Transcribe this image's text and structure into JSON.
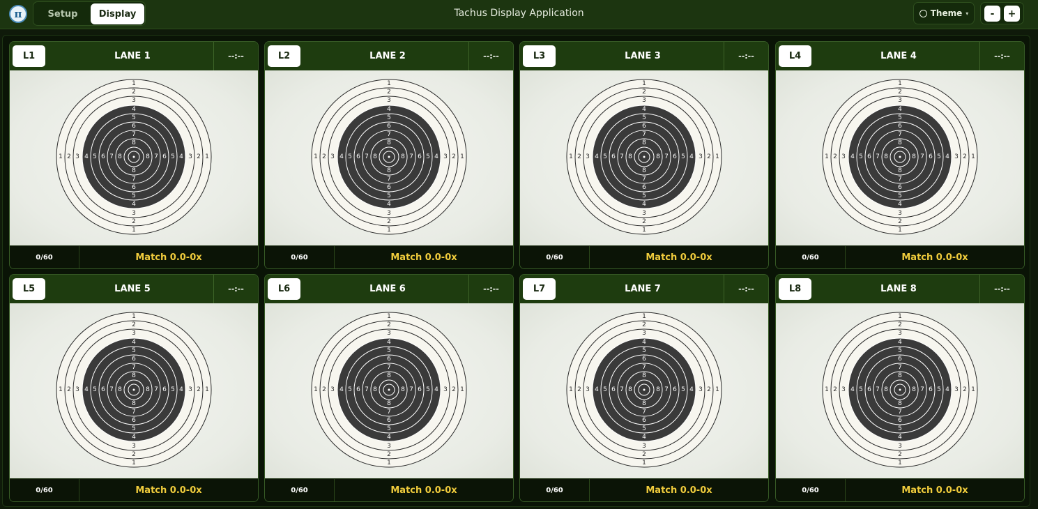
{
  "app": {
    "title": "Tachus Display Application",
    "logo_glyph": "π",
    "logo_icon": "pi-logo-icon"
  },
  "tabs": [
    {
      "label": "Setup",
      "active": false
    },
    {
      "label": "Display",
      "active": true
    }
  ],
  "theme": {
    "label": "Theme",
    "caret": "▾",
    "icon": "circle-icon"
  },
  "zoom": {
    "minus": "-",
    "plus": "+"
  },
  "target": {
    "ring_labels": [
      "1",
      "2",
      "3",
      "4",
      "5",
      "6",
      "7",
      "8",
      "8",
      "7",
      "6",
      "5",
      "4",
      "3",
      "2",
      "1"
    ],
    "colors": {
      "paper": "#f7f6ef",
      "black": "#3a3a3a",
      "ring_line": "#2a2a2a"
    }
  },
  "lanes": [
    {
      "badge": "L1",
      "name": "LANE 1",
      "time": "--:--",
      "shots": "0/60",
      "score": "Match 0.0-0x"
    },
    {
      "badge": "L2",
      "name": "LANE 2",
      "time": "--:--",
      "shots": "0/60",
      "score": "Match 0.0-0x"
    },
    {
      "badge": "L3",
      "name": "LANE 3",
      "time": "--:--",
      "shots": "0/60",
      "score": "Match 0.0-0x"
    },
    {
      "badge": "L4",
      "name": "LANE 4",
      "time": "--:--",
      "shots": "0/60",
      "score": "Match 0.0-0x"
    },
    {
      "badge": "L5",
      "name": "LANE 5",
      "time": "--:--",
      "shots": "0/60",
      "score": "Match 0.0-0x"
    },
    {
      "badge": "L6",
      "name": "LANE 6",
      "time": "--:--",
      "shots": "0/60",
      "score": "Match 0.0-0x"
    },
    {
      "badge": "L7",
      "name": "LANE 7",
      "time": "--:--",
      "shots": "0/60",
      "score": "Match 0.0-0x"
    },
    {
      "badge": "L8",
      "name": "LANE 8",
      "time": "--:--",
      "shots": "0/60",
      "score": "Match 0.0-0x"
    }
  ]
}
